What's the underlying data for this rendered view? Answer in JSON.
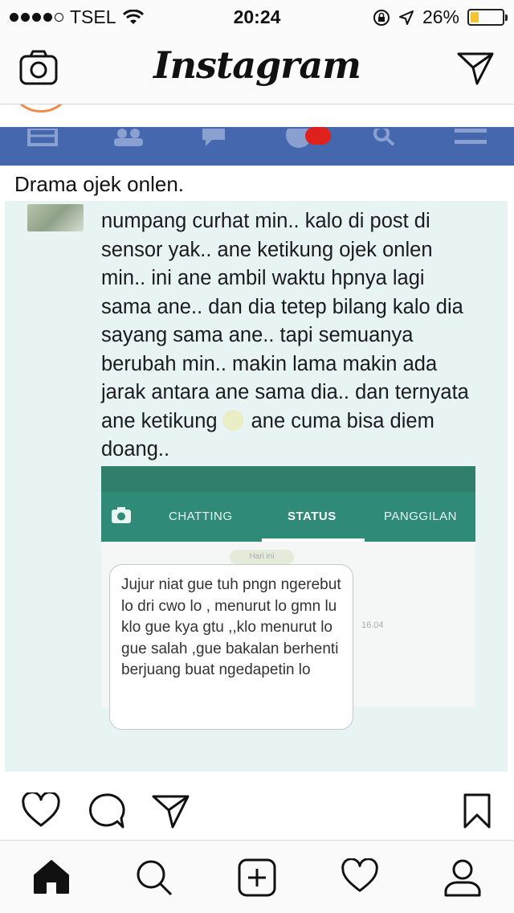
{
  "status_bar": {
    "carrier": "TSEL",
    "time": "20:24",
    "battery_percent": "26%",
    "battery_level": 0.26,
    "signal_icon": "signal-dots-icon",
    "wifi_icon": "wifi-icon",
    "lock_icon": "rotation-lock-icon",
    "location_icon": "location-arrow-icon"
  },
  "header": {
    "title": "Instagram",
    "camera_icon": "camera-icon",
    "direct_icon": "paper-plane-icon"
  },
  "post": {
    "caption_title": "Drama ojek onlen.",
    "facebook_bar_color": "#4467ad",
    "message": "numpang curhat min.. kalo di post di sensor yak.. ane ketikung ojek onlen min.. ini ane ambil waktu hpnya lagi sama ane.. dan dia tetep bilang kalo dia sayang sama ane.. tapi semuanya berubah min.. makin lama makin ada jarak antara ane sama dia.. dan ternyata ane ketikung",
    "message_end": "ane cuma bisa diem doang..",
    "whatsapp": {
      "tabs": [
        "CHATTING",
        "STATUS",
        "PANGGILAN"
      ],
      "date_chip": "Hari ini",
      "bubble_text": "Jujur niat gue tuh pngn ngerebut lo dri cwo lo , menurut lo gmn lu klo gue kya gtu ,,klo menurut lo gue salah ,gue bakalan berhenti berjuang buat ngedapetin lo",
      "bubble_time": "16.04",
      "header_color": "#2f8b77"
    }
  },
  "actions": {
    "like_icon": "heart-icon",
    "comment_icon": "comment-icon",
    "share_icon": "paper-plane-icon",
    "save_icon": "bookmark-icon"
  },
  "tabbar": {
    "home_icon": "home-icon",
    "search_icon": "search-icon",
    "add_icon": "add-post-icon",
    "activity_icon": "heart-icon",
    "profile_icon": "profile-icon"
  }
}
